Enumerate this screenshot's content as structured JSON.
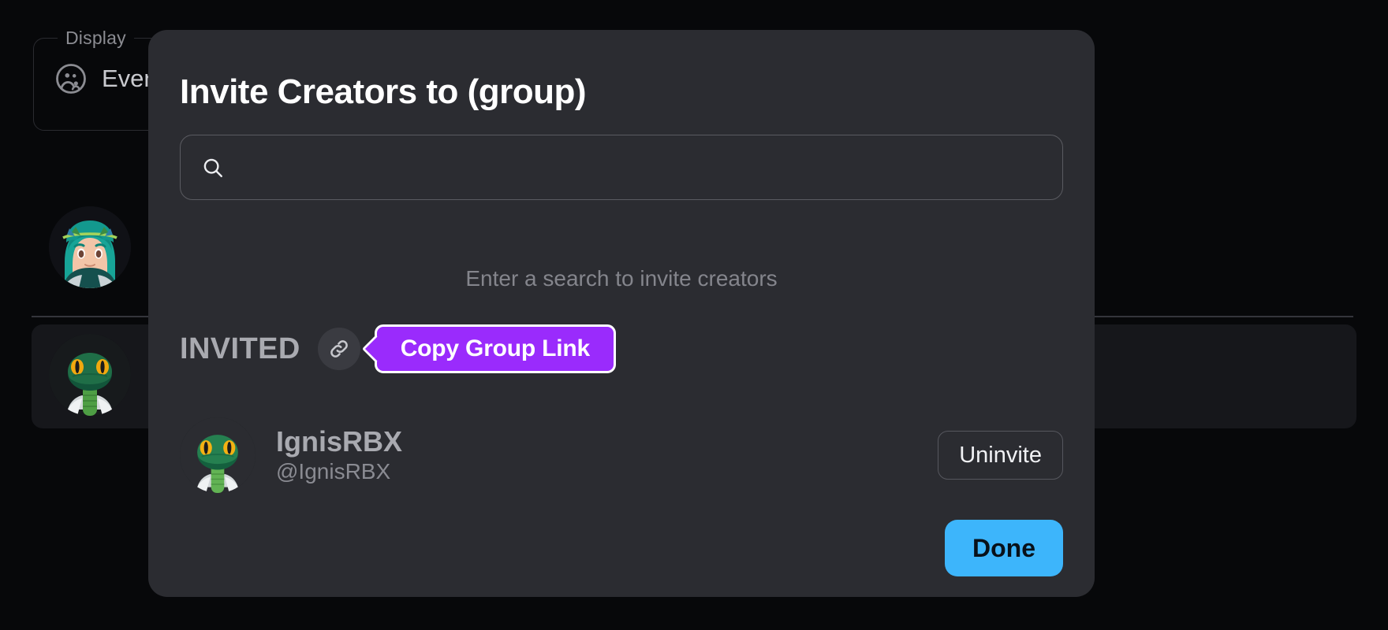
{
  "background": {
    "display_fieldset": {
      "legend": "Display",
      "icon": "people-group-icon",
      "value": "Everyone"
    },
    "avatars": [
      {
        "icon": "avatar-anime-green-hair"
      },
      {
        "icon": "avatar-green-snake"
      }
    ]
  },
  "modal": {
    "title": "Invite Creators to (group)",
    "search": {
      "icon": "search-icon",
      "value": "",
      "placeholder": ""
    },
    "empty_hint": "Enter a search to invite creators",
    "invited": {
      "label": "INVITED",
      "link_button_icon": "link-chain-icon",
      "tooltip": {
        "text": "Copy Group Link",
        "background_color": "#9A2BFC",
        "border_color": "#FFFFFF"
      }
    },
    "members": [
      {
        "avatar_icon": "avatar-green-snake",
        "display_name": "IgnisRBX",
        "handle": "@IgnisRBX",
        "action_label": "Uninvite"
      }
    ],
    "done_label": "Done",
    "done_color": "#3DB5FB",
    "background_color": "#2B2C31"
  }
}
